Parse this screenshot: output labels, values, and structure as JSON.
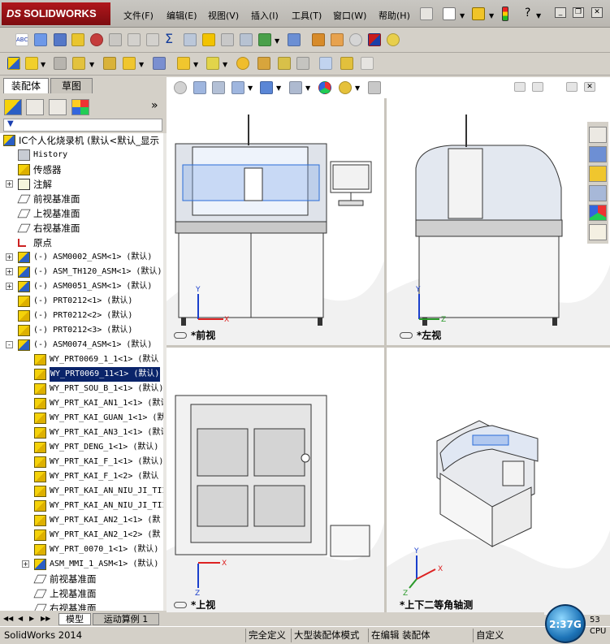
{
  "app": {
    "logo_ds": "𝐃𝐒",
    "logo_text": "SOLIDWORKS"
  },
  "menus": [
    "文件(F)",
    "编辑(E)",
    "视图(V)",
    "插入(I)",
    "工具(T)",
    "窗口(W)",
    "帮助(H)"
  ],
  "titlebar_icons": [
    "pin-icon",
    "new-document-icon",
    "open-file-icon",
    "traffic-light-icon",
    "help-icon"
  ],
  "panel": {
    "tabs": [
      "装配体",
      "草图"
    ],
    "filter_icon": "funnel-icon",
    "expand_glyph": "»"
  },
  "tree": [
    {
      "label": "IC个人化烧录机  (默认<默认_显示",
      "type": "asm",
      "indent": 0,
      "cn": true
    },
    {
      "label": "History",
      "type": "history",
      "indent": 1
    },
    {
      "label": "传感器",
      "type": "folder",
      "indent": 1,
      "cn": true
    },
    {
      "label": "注解",
      "type": "annotation",
      "indent": 1,
      "pm": "+",
      "cn": true
    },
    {
      "label": "前视基准面",
      "type": "plane",
      "indent": 1,
      "cn": true
    },
    {
      "label": "上视基准面",
      "type": "plane",
      "indent": 1,
      "cn": true
    },
    {
      "label": "右视基准面",
      "type": "plane",
      "indent": 1,
      "cn": true
    },
    {
      "label": "原点",
      "type": "origin",
      "indent": 1,
      "cn": true
    },
    {
      "label": "(-) ASM0002_ASM<1> (默认)",
      "type": "asm",
      "indent": 1,
      "pm": "+"
    },
    {
      "label": "(-) ASM_TH120_ASM<1> (默认)",
      "type": "asm",
      "indent": 1,
      "pm": "+"
    },
    {
      "label": "(-) ASM0051_ASM<1> (默认)",
      "type": "asm",
      "indent": 1,
      "pm": "+"
    },
    {
      "label": "(-) PRT0212<1> (默认)",
      "type": "part",
      "indent": 1
    },
    {
      "label": "(-) PRT0212<2> (默认)",
      "type": "part",
      "indent": 1
    },
    {
      "label": "(-) PRT0212<3> (默认)",
      "type": "part",
      "indent": 1
    },
    {
      "label": "(-) ASM0074_ASM<1> (默认)",
      "type": "asm",
      "indent": 1,
      "pm": "-"
    },
    {
      "label": "WY_PRT0069_1_1<1> (默认",
      "type": "part",
      "indent": 2
    },
    {
      "label": "WY_PRT0069_11<1> (默认)",
      "type": "part",
      "indent": 2,
      "selected": true
    },
    {
      "label": "WY_PRT_SOU_B_1<1> (默认)",
      "type": "part",
      "indent": 2
    },
    {
      "label": "WY_PRT_KAI_AN1_1<1> (默认",
      "type": "part",
      "indent": 2
    },
    {
      "label": "WY_PRT_KAI_GUAN_1<1> (默",
      "type": "part",
      "indent": 2
    },
    {
      "label": "WY_PRT_KAI_AN3_1<1> (默认",
      "type": "part",
      "indent": 2
    },
    {
      "label": "WY_PRT_DENG_1<1> (默认)",
      "type": "part",
      "indent": 2
    },
    {
      "label": "WY_PRT_KAI_F_1<1> (默认)",
      "type": "part",
      "indent": 2
    },
    {
      "label": "WY_PRT_KAI_F_1<2> (默认",
      "type": "part",
      "indent": 2
    },
    {
      "label": "WY_PRT_KAI_AN_NIU_JI_TII",
      "type": "part",
      "indent": 2
    },
    {
      "label": "WY_PRT_KAI_AN_NIU_JI_TII",
      "type": "part",
      "indent": 2
    },
    {
      "label": "WY_PRT_KAI_AN2_1<1> (默",
      "type": "part",
      "indent": 2
    },
    {
      "label": "WY_PRT_KAI_AN2_1<2> (默",
      "type": "part",
      "indent": 2
    },
    {
      "label": "WY_PRT_0070_1<1> (默认)",
      "type": "part",
      "indent": 2
    },
    {
      "label": "ASM_MMI_1_ASM<1> (默认)",
      "type": "asm",
      "indent": 2,
      "pm": "+"
    },
    {
      "label": "前视基准面",
      "type": "plane",
      "indent": 2,
      "cn": true
    },
    {
      "label": "上视基准面",
      "type": "plane",
      "indent": 2,
      "cn": true
    },
    {
      "label": "右视基准面",
      "type": "plane",
      "indent": 2,
      "cn": true
    }
  ],
  "viewports": [
    {
      "label": "*前视"
    },
    {
      "label": "*左视"
    },
    {
      "label": "*上视"
    },
    {
      "label": "*上下二等角轴测"
    }
  ],
  "axes": {
    "x": "X",
    "y": "Y",
    "z": "Z"
  },
  "bottom_tabs": [
    "模型",
    "运动算例 1"
  ],
  "status": {
    "app": "SolidWorks 2014",
    "defined": "完全定义",
    "mode": "大型装配体模式",
    "editing": "在编辑 装配体",
    "units": "自定义"
  },
  "tray": {
    "clock": "2:37G",
    "cpu_top": "53",
    "cpu_label": "CPU"
  }
}
